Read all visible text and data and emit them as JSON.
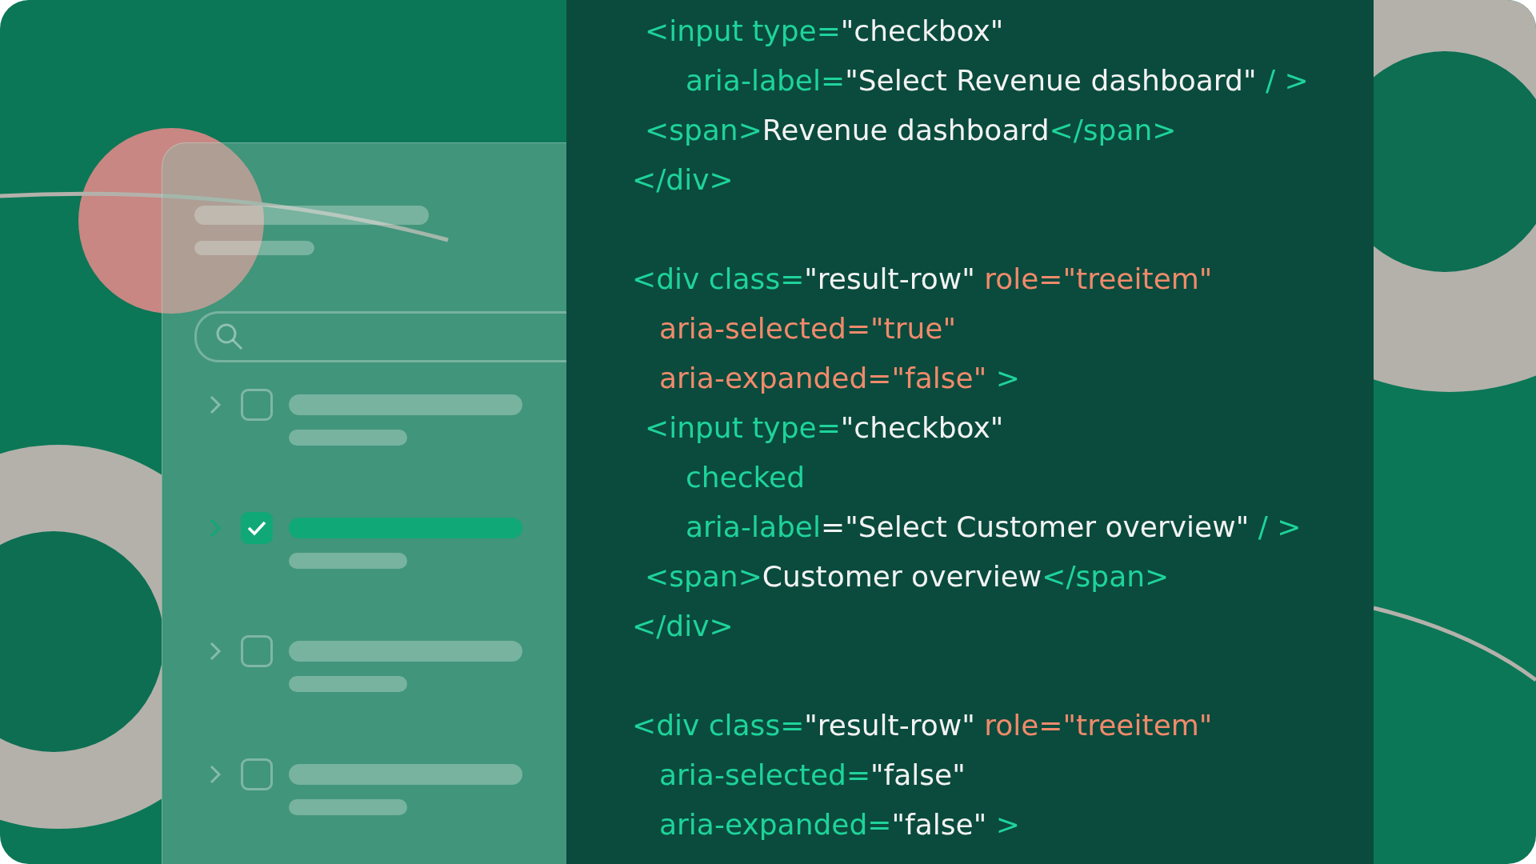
{
  "mockup": {
    "rows": [
      {
        "checked": false
      },
      {
        "checked": true
      },
      {
        "checked": false
      },
      {
        "checked": false
      }
    ]
  },
  "code": {
    "lines": [
      {
        "kind": "child",
        "tokens": [
          {
            "kind": "tag",
            "t": "<input type="
          },
          {
            "kind": "value",
            "t": "\"checkbox\""
          }
        ]
      },
      {
        "kind": "child_attr",
        "tokens": [
          {
            "kind": "tag",
            "t": "aria-label="
          },
          {
            "kind": "value",
            "t": "\"Select Revenue dashboard\""
          },
          {
            "kind": "tag",
            "t": " / >"
          }
        ]
      },
      {
        "kind": "child",
        "tokens": [
          {
            "kind": "tag",
            "t": "<span>"
          },
          {
            "kind": "value",
            "t": "Revenue dashboard"
          },
          {
            "kind": "tag",
            "t": "</span>"
          }
        ]
      },
      {
        "kind": "open",
        "tokens": [
          {
            "kind": "tag",
            "t": "</div>"
          }
        ]
      },
      {
        "kind": "open",
        "spaced": true,
        "tokens": [
          {
            "kind": "tag",
            "t": "<div class="
          },
          {
            "kind": "value",
            "t": "\"result-row\""
          },
          {
            "kind": "attr",
            "t": " role=\"treeitem\""
          }
        ]
      },
      {
        "kind": "attr",
        "tokens": [
          {
            "kind": "attr",
            "t": "aria-selected=\"true\""
          }
        ]
      },
      {
        "kind": "attr",
        "tokens": [
          {
            "kind": "attr",
            "t": "aria-expanded=\"false\""
          },
          {
            "kind": "tag",
            "t": " >"
          }
        ]
      },
      {
        "kind": "child",
        "tokens": [
          {
            "kind": "tag",
            "t": "<input type="
          },
          {
            "kind": "value",
            "t": "\"checkbox\""
          }
        ]
      },
      {
        "kind": "child_attr",
        "tokens": [
          {
            "kind": "tag",
            "t": "checked"
          }
        ]
      },
      {
        "kind": "child_attr",
        "tokens": [
          {
            "kind": "tag",
            "t": "aria-label"
          },
          {
            "kind": "value",
            "t": "=\"Select Customer overview\""
          },
          {
            "kind": "tag",
            "t": " / >"
          }
        ]
      },
      {
        "kind": "child",
        "tokens": [
          {
            "kind": "tag",
            "t": "<span>"
          },
          {
            "kind": "value",
            "t": "Customer overview"
          },
          {
            "kind": "tag",
            "t": "</span>"
          }
        ]
      },
      {
        "kind": "open",
        "tokens": [
          {
            "kind": "tag",
            "t": "</div>"
          }
        ]
      },
      {
        "kind": "open",
        "spaced": true,
        "tokens": [
          {
            "kind": "tag",
            "t": "<div class="
          },
          {
            "kind": "value",
            "t": "\"result-row\""
          },
          {
            "kind": "attr",
            "t": " role=\"treeitem\""
          }
        ]
      },
      {
        "kind": "attr",
        "tokens": [
          {
            "kind": "tag",
            "t": "aria-selected="
          },
          {
            "kind": "value",
            "t": "\"false\""
          }
        ]
      },
      {
        "kind": "attr",
        "tokens": [
          {
            "kind": "tag",
            "t": "aria-expanded="
          },
          {
            "kind": "value",
            "t": "\"false\""
          },
          {
            "kind": "tag",
            "t": " >"
          }
        ]
      }
    ]
  }
}
